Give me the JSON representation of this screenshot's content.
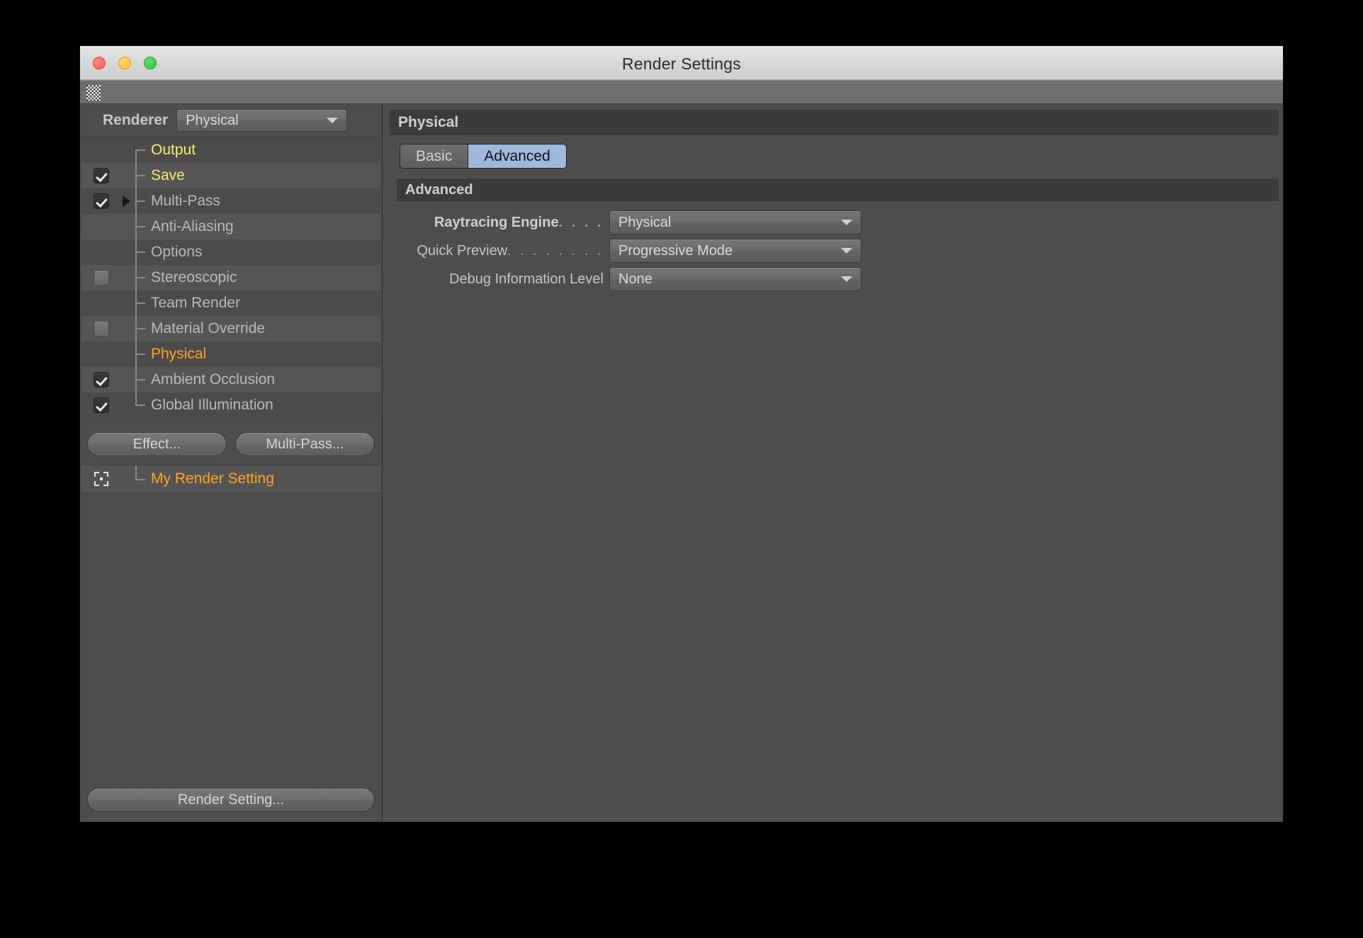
{
  "window": {
    "title": "Render Settings",
    "traffic_lights": [
      "close",
      "minimize",
      "maximize"
    ]
  },
  "left_panel": {
    "renderer_label": "Renderer",
    "renderer_value": "Physical",
    "tree_items": [
      {
        "label": "Output",
        "color": "yellow",
        "checkbox": "none",
        "expandable": false
      },
      {
        "label": "Save",
        "color": "yellow",
        "checkbox": "checked",
        "expandable": false
      },
      {
        "label": "Multi-Pass",
        "color": "gray",
        "checkbox": "checked",
        "expandable": true
      },
      {
        "label": "Anti-Aliasing",
        "color": "gray",
        "checkbox": "none",
        "expandable": false
      },
      {
        "label": "Options",
        "color": "gray",
        "checkbox": "none",
        "expandable": false
      },
      {
        "label": "Stereoscopic",
        "color": "gray",
        "checkbox": "unchecked",
        "expandable": false
      },
      {
        "label": "Team Render",
        "color": "gray",
        "checkbox": "none",
        "expandable": false
      },
      {
        "label": "Material Override",
        "color": "gray",
        "checkbox": "unchecked",
        "expandable": false
      },
      {
        "label": "Physical",
        "color": "orange",
        "checkbox": "none",
        "expandable": false
      },
      {
        "label": "Ambient Occlusion",
        "color": "gray",
        "checkbox": "checked",
        "expandable": false
      },
      {
        "label": "Global Illumination",
        "color": "gray",
        "checkbox": "checked",
        "expandable": false
      }
    ],
    "effect_button": "Effect...",
    "multipass_button": "Multi-Pass...",
    "saved_setting": "My Render Setting",
    "render_setting_button": "Render Setting..."
  },
  "right_panel": {
    "header": "Physical",
    "tabs": [
      {
        "label": "Basic",
        "active": false
      },
      {
        "label": "Advanced",
        "active": true
      }
    ],
    "section_title": "Advanced",
    "fields": [
      {
        "label": "Raytracing Engine",
        "leader": ". . . .",
        "bold": true,
        "value": "Physical"
      },
      {
        "label": "Quick Preview",
        "leader": ". . . . . . . .",
        "bold": false,
        "value": "Progressive Mode"
      },
      {
        "label": "Debug Information Level",
        "leader": "",
        "bold": false,
        "value": "None"
      }
    ]
  },
  "colors": {
    "accent_orange": "#ffa31f",
    "accent_yellow": "#f2ef6c",
    "tab_active": "#9fb8dd",
    "panel_bg": "#4d4d4d",
    "header_bg": "#3b3b3b"
  }
}
